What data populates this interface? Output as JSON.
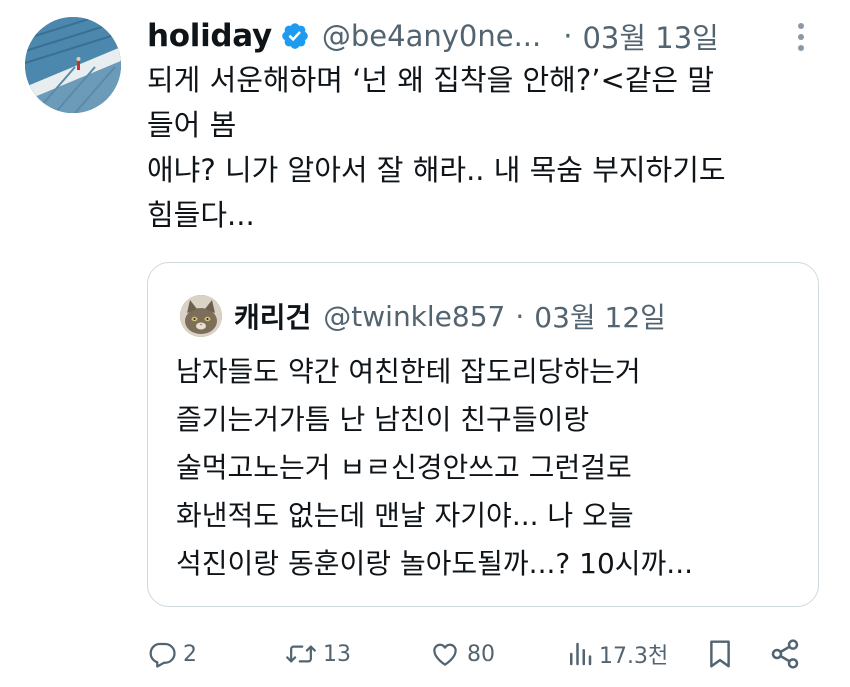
{
  "author": {
    "display_name": "holiday",
    "handle": "@be4any0ne...",
    "separator": "·",
    "date": "03월 13일"
  },
  "tweet": {
    "lines": [
      "되게 서운해하며 ‘넌 왜 집착을 안해?’<같은 말",
      "들어 봄",
      "애냐? 니가 알아서 잘 해라.. 내 목숨 부지하기도",
      "힘들다..."
    ]
  },
  "quoted_tweet": {
    "display_name": "캐리건",
    "handle": "@twinkle857",
    "separator": "·",
    "date": "03월 12일",
    "lines": [
      "남자들도 약간 여친한테 잡도리당하는거",
      "즐기는거가틈 난 남친이 친구들이랑",
      "술먹고노는거 ㅂㄹ신경안쓰고 그런걸로",
      "화낸적도 없는데 맨날 자기야... 나 오늘",
      "석진이랑 동훈이랑 놀아도될까...? 10시까..."
    ]
  },
  "actions": {
    "reply_count": "2",
    "retweet_count": "13",
    "like_count": "80",
    "view_count": "17.3천"
  },
  "icons": {
    "verified": "verified-badge-icon",
    "more": "more-dots-icon",
    "reply": "reply-icon",
    "retweet": "retweet-icon",
    "like": "heart-icon",
    "views": "views-chart-icon",
    "bookmark": "bookmark-icon",
    "share": "share-icon"
  },
  "colors": {
    "text": "#0f1419",
    "secondary": "#536471",
    "verified": "#1d9bf0",
    "border": "#cfd9de"
  }
}
